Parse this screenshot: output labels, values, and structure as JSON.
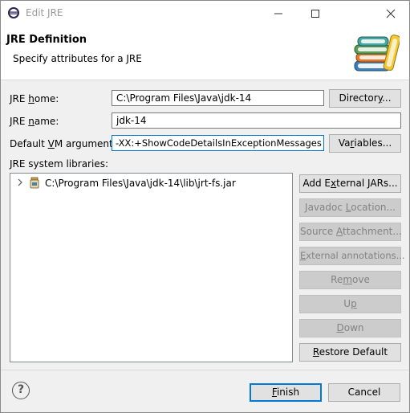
{
  "window": {
    "title": "Edit JRE"
  },
  "header": {
    "title": "JRE Definition",
    "description": "Specify attributes for a JRE"
  },
  "form": {
    "jre_home": {
      "label_pre": "JRE ",
      "label_u": "h",
      "label_post": "ome:",
      "value": "C:\\Program Files\\Java\\jdk-14",
      "button": {
        "pre": "Director",
        "u": "y",
        "post": "..."
      }
    },
    "jre_name": {
      "label_pre": "JRE ",
      "label_u": "n",
      "label_post": "ame:",
      "value": "jdk-14"
    },
    "vm_args": {
      "label_pre": "Default ",
      "label_u": "V",
      "label_post": "M arguments:",
      "value": "-XX:+ShowCodeDetailsInExceptionMessages",
      "button": {
        "pre": "Va",
        "u": "r",
        "post": "iables..."
      }
    },
    "libraries_label": "JRE system libraries:"
  },
  "libraries": [
    {
      "path": "C:\\Program Files\\Java\\jdk-14\\lib\\jrt-fs.jar",
      "icon": "jar-icon"
    }
  ],
  "library_buttons": {
    "add_external": {
      "pre": "Add E",
      "u": "x",
      "post": "ternal JARs..."
    },
    "javadoc": {
      "pre": "Javadoc ",
      "u": "L",
      "post": "ocation..."
    },
    "source": {
      "pre": "Source ",
      "u": "A",
      "post": "ttachment..."
    },
    "annotations": {
      "pre": "",
      "u": "E",
      "post": "xternal annotations..."
    },
    "remove": {
      "pre": "Re",
      "u": "m",
      "post": "ove"
    },
    "up": {
      "pre": "U",
      "u": "p",
      "post": ""
    },
    "down": {
      "pre": "",
      "u": "D",
      "post": "own"
    },
    "restore": {
      "pre": "",
      "u": "R",
      "post": "estore Default"
    }
  },
  "footer": {
    "finish": {
      "pre": "",
      "u": "F",
      "post": "inish"
    },
    "cancel": "Cancel",
    "help_glyph": "?"
  },
  "colors": {
    "accent": "#0078d7",
    "disabled_bg": "#cccccc",
    "disabled_text": "#838383"
  }
}
